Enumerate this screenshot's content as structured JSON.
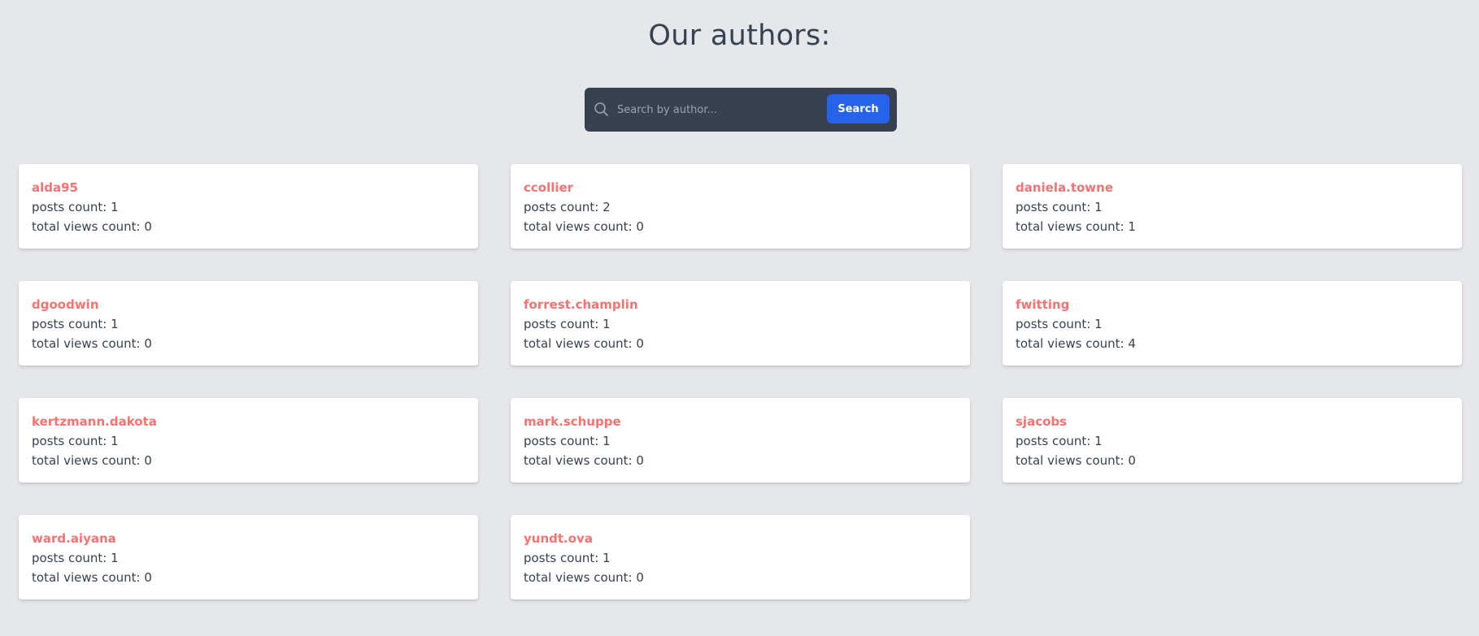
{
  "page": {
    "title": "Our authors:"
  },
  "search": {
    "placeholder": "Search by author...",
    "button_label": "Search",
    "icon": "search-icon"
  },
  "labels": {
    "posts_prefix": "posts count: ",
    "views_prefix": "total views count: "
  },
  "colors": {
    "author_name": "#f87171",
    "search_button": "#2563eb",
    "search_bar": "#374151",
    "background": "#e5e7eb"
  },
  "authors": [
    {
      "name": "alda95",
      "posts": 1,
      "views": 0
    },
    {
      "name": "ccollier",
      "posts": 2,
      "views": 0
    },
    {
      "name": "daniela.towne",
      "posts": 1,
      "views": 1
    },
    {
      "name": "dgoodwin",
      "posts": 1,
      "views": 0
    },
    {
      "name": "forrest.champlin",
      "posts": 1,
      "views": 0
    },
    {
      "name": "fwitting",
      "posts": 1,
      "views": 4
    },
    {
      "name": "kertzmann.dakota",
      "posts": 1,
      "views": 0
    },
    {
      "name": "mark.schuppe",
      "posts": 1,
      "views": 0
    },
    {
      "name": "sjacobs",
      "posts": 1,
      "views": 0
    },
    {
      "name": "ward.aiyana",
      "posts": 1,
      "views": 0
    },
    {
      "name": "yundt.ova",
      "posts": 1,
      "views": 0
    }
  ]
}
